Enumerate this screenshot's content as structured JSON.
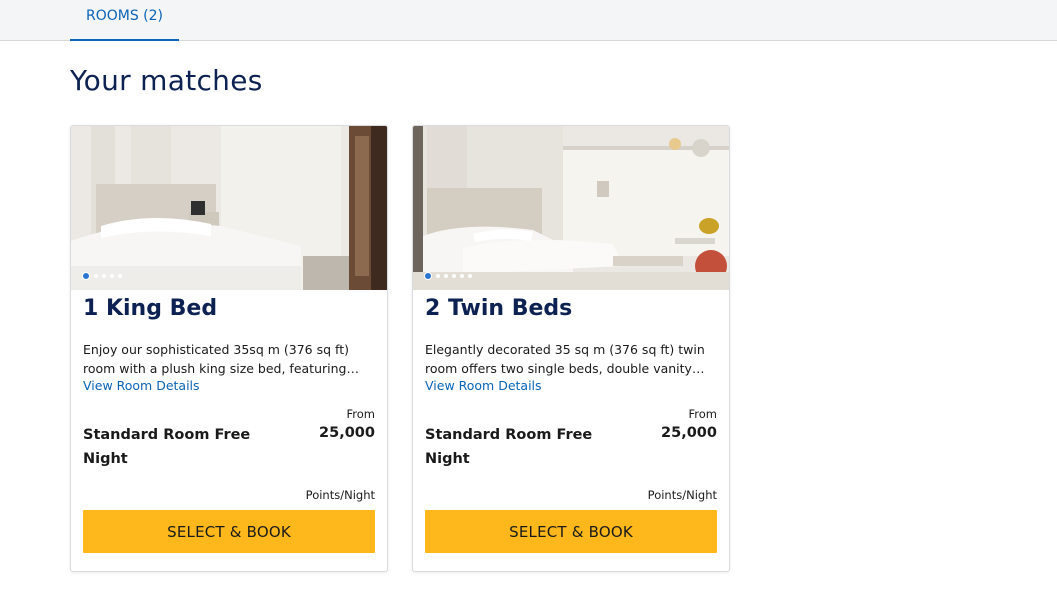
{
  "tabs": {
    "rooms": "ROOMS (2)"
  },
  "heading": "Your matches",
  "colors": {
    "accent": "#0b64b6",
    "title": "#0d2252",
    "button": "#ffb81c"
  },
  "rooms": [
    {
      "title": "1 King Bed",
      "description": "Enjoy our sophisticated 35sq m (376 sq ft) room with a plush king size bed, featuring…",
      "link": "View Room Details",
      "rate_name": "Standard Room Free Night",
      "from_label": "From",
      "price": "25,000",
      "unit": "Points/Night",
      "button": "SELECT & BOOK",
      "carousel": {
        "count": 5,
        "active": 1
      }
    },
    {
      "title": "2 Twin Beds",
      "description": "Elegantly decorated 35 sq m (376 sq ft) twin room offers two single beds, double vanity…",
      "link": "View Room Details",
      "rate_name": "Standard Room Free Night",
      "from_label": "From",
      "price": "25,000",
      "unit": "Points/Night",
      "button": "SELECT & BOOK",
      "carousel": {
        "count": 6,
        "active": 1
      }
    }
  ]
}
